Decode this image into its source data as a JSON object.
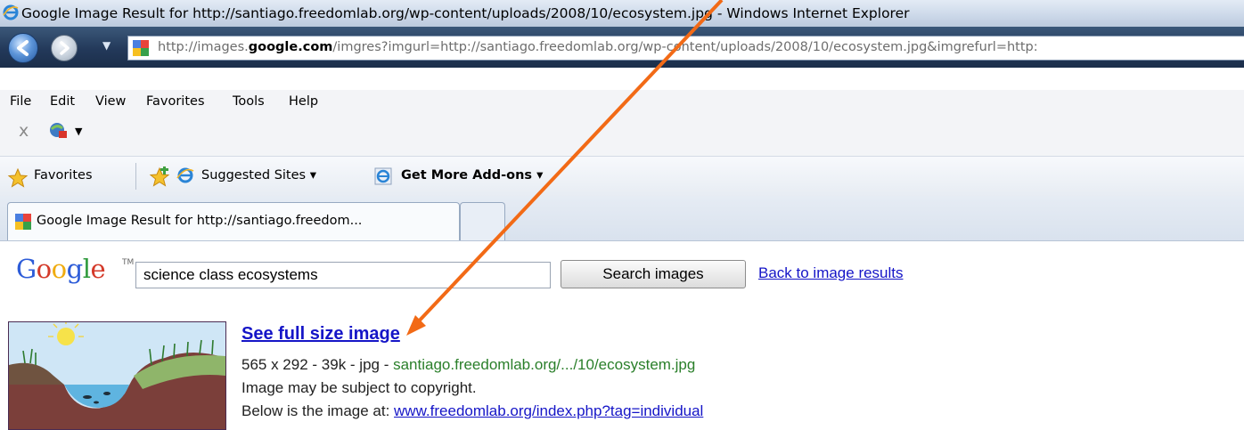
{
  "window": {
    "title": "Google Image Result for http://santiago.freedomlab.org/wp-content/uploads/2008/10/ecosystem.jpg - Windows Internet Explorer"
  },
  "address_bar": {
    "url_prefix": "http://images.",
    "url_domain": "google.com",
    "url_suffix": "/imgres?imgurl=http://santiago.freedomlab.org/wp-content/uploads/2008/10/ecosystem.jpg&imgrefurl=http:"
  },
  "menu": {
    "items": [
      "File",
      "Edit",
      "View",
      "Favorites",
      "Tools",
      "Help"
    ]
  },
  "command_bar": {
    "close_glyph": "x",
    "dropdown_glyph": "▼"
  },
  "favorites_bar": {
    "favorites_label": "Favorites",
    "suggested_sites": "Suggested Sites ▾",
    "get_more_addons": "Get More Add-ons ▾"
  },
  "tabs": {
    "active_label": "Google Image Result for http://santiago.freedom..."
  },
  "google_bar": {
    "logo": "Google",
    "tm": "TM",
    "search_value": "science class ecosystems",
    "search_button": "Search images",
    "back_link": "Back to image results"
  },
  "result": {
    "see_full_size": "See full size image",
    "meta": "565 x 292 - 39k - jpg - ",
    "source_url": "santiago.freedomlab.org/.../10/ecosystem.jpg",
    "copyright": "Image may be subject to copyright.",
    "below_prefix": "Below is the image at: ",
    "below_link": "www.freedomlab.org/index.php?tag=individual"
  },
  "colors": {
    "arrow": "#f26a16",
    "link": "#1515c7",
    "url_green": "#2a7f2a"
  }
}
